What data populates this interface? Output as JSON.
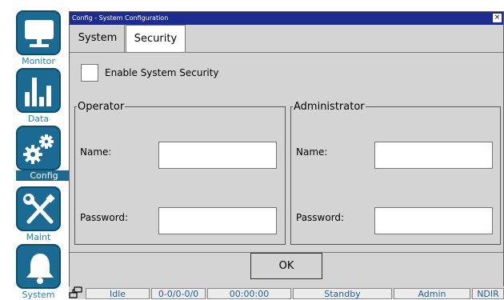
{
  "sidebar": {
    "items": [
      {
        "label": "Monitor",
        "icon": "monitor-icon"
      },
      {
        "label": "Data",
        "icon": "bar-chart-icon"
      },
      {
        "label": "Config",
        "icon": "gears-icon",
        "active": true
      },
      {
        "label": "Maint",
        "icon": "wrench-screwdriver-icon"
      },
      {
        "label": "System",
        "icon": "bell-icon"
      }
    ]
  },
  "window": {
    "title": "Config - System Configuration",
    "close_label": "×",
    "tabs": [
      {
        "label": "System",
        "selected": false
      },
      {
        "label": "Security",
        "selected": true
      }
    ]
  },
  "security": {
    "enable_label": "Enable System Security",
    "enable_checked": false,
    "operator": {
      "legend": "Operator",
      "name_label": "Name:",
      "name_value": "",
      "password_label": "Password:",
      "password_value": ""
    },
    "administrator": {
      "legend": "Administrator",
      "name_label": "Name:",
      "name_value": "",
      "password_label": "Password:",
      "password_value": ""
    },
    "ok_label": "OK"
  },
  "statusbar": {
    "cells": [
      "Idle",
      "0-0/0-0/0",
      "00:00:00",
      "Standby",
      "Admin",
      "NDIR"
    ]
  },
  "colors": {
    "nav_tile": "#1b6a93",
    "nav_label": "#2a7fb0",
    "titlebar": "#1d2d8f",
    "panel": "#d4d4d4",
    "status_text": "#1f5f96"
  }
}
